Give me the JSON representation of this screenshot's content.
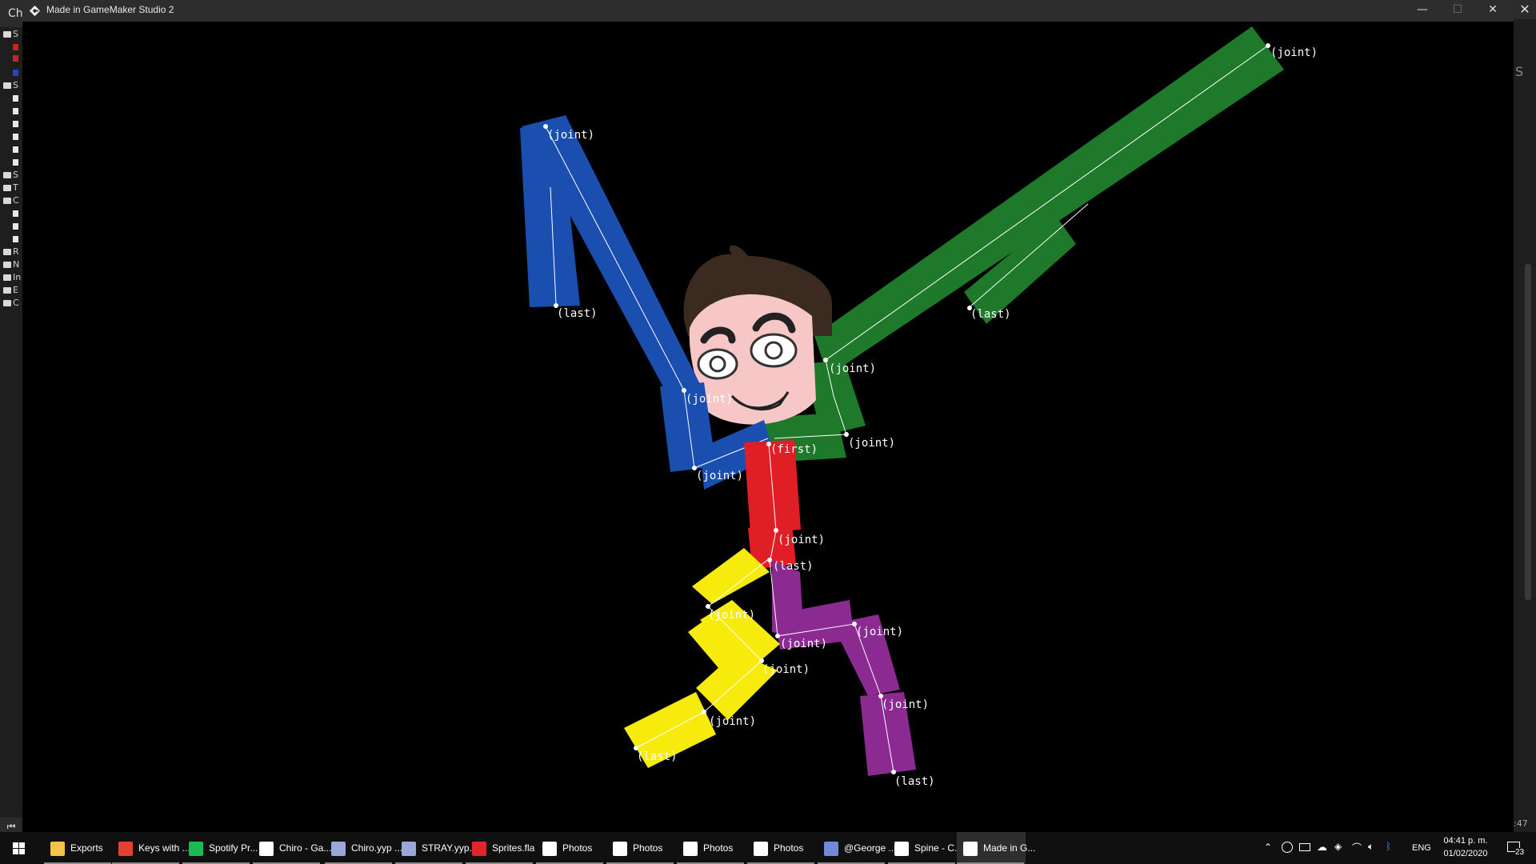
{
  "window": {
    "title": "Made in GameMaker Studio 2",
    "minimize_icon": "minimize-icon",
    "maximize_icon": "maximize-icon",
    "close_icon": "close-icon"
  },
  "background_app": {
    "left_header": "Ch",
    "left_tree_letters": [
      "S",
      "",
      "",
      "",
      "S",
      "",
      "",
      "",
      "",
      "",
      "",
      "S",
      "T",
      "C",
      "",
      "",
      "",
      "R",
      "N",
      "In",
      "E",
      "C"
    ],
    "right_letter": "S",
    "right_time": ":47"
  },
  "skeleton": {
    "colors": {
      "blue": "#1a4fb0",
      "green": "#1e7a2a",
      "red": "#e01e25",
      "yellow": "#f6eb0c",
      "purple": "#8b2a90",
      "bone_line": "#ffffff"
    },
    "labels": [
      "(joint)",
      "(last)",
      "(joint)",
      "(joint)",
      "(joint)",
      "(last)",
      "(joint)",
      "(joint)",
      "(first)",
      "(joint)",
      "(last)",
      "(joint)",
      "(joint)",
      "(joint)",
      "(last)",
      "(joint)",
      "(joint)",
      "(joint)",
      "(last)"
    ]
  },
  "taskbar": {
    "items": [
      {
        "label": "Exports",
        "icon": "folder-icon",
        "color": "#f2c44a"
      },
      {
        "label": "Keys with ...",
        "icon": "chrome-icon",
        "color": "#e34133"
      },
      {
        "label": "Spotify Pr...",
        "icon": "spotify-icon",
        "color": "#1db954"
      },
      {
        "label": "Chiro - Ga...",
        "icon": "gamemaker-icon",
        "color": "#ffffff"
      },
      {
        "label": "Chiro.yyp ...",
        "icon": "gamemaker-icon",
        "color": "#9aa8d8"
      },
      {
        "label": "STRAY.yyp...",
        "icon": "gamemaker-icon",
        "color": "#9aa8d8"
      },
      {
        "label": "Sprites.fla",
        "icon": "flash-icon",
        "color": "#e0262c"
      },
      {
        "label": "Photos",
        "icon": "photos-icon",
        "color": "#ffffff"
      },
      {
        "label": "Photos",
        "icon": "photos-icon",
        "color": "#ffffff"
      },
      {
        "label": "Photos",
        "icon": "photos-icon",
        "color": "#ffffff"
      },
      {
        "label": "Photos",
        "icon": "photos-icon",
        "color": "#ffffff"
      },
      {
        "label": "@George ...",
        "icon": "discord-icon",
        "color": "#7289da"
      },
      {
        "label": "Spine - C...",
        "icon": "spine-icon",
        "color": "#ffffff"
      },
      {
        "label": "Made in G...",
        "icon": "gamemaker-icon",
        "color": "#ffffff"
      }
    ],
    "tray": {
      "language": "ENG",
      "time": "04:41 p. m.",
      "date": "01/02/2020",
      "notification_count": "23"
    }
  }
}
